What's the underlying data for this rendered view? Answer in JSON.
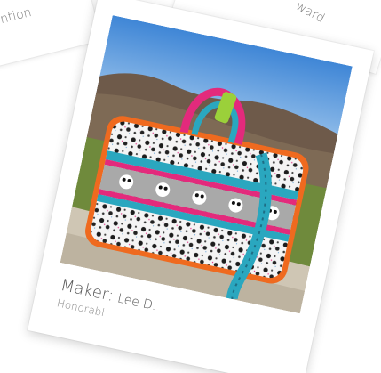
{
  "background_cards": {
    "left_text": "ntion",
    "right_text": "ward"
  },
  "photo_card": {
    "photo_subject": "Quilted bag with panda print fabric, orange zipper trim, pink and teal straps",
    "maker_label": "Maker:",
    "maker_name": "Lee D.",
    "award": "Honorabl"
  }
}
